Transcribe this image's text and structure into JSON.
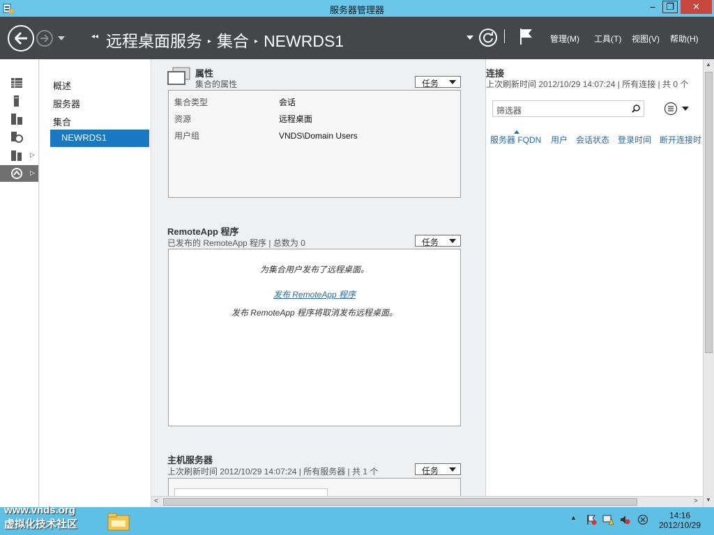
{
  "window": {
    "title": "服务器管理器",
    "minimize": "–",
    "maximize": "❐",
    "close": "✕"
  },
  "header": {
    "breadcrumb": [
      "远程桌面服务",
      "集合",
      "NEWRDS1"
    ],
    "menus": [
      "管理(M)",
      "工具(T)",
      "视图(V)",
      "帮助(H)"
    ]
  },
  "subnav": {
    "items": [
      "概述",
      "服务器",
      "集合"
    ],
    "selected": "NEWRDS1"
  },
  "properties": {
    "title": "属性",
    "subtitle": "集合的属性",
    "task_label": "任务",
    "rows": [
      {
        "key": "集合类型",
        "value": "会话"
      },
      {
        "key": "资源",
        "value": "远程桌面"
      },
      {
        "key": "用户组",
        "value": "VNDS\\Domain Users"
      }
    ]
  },
  "remoteapp": {
    "title": "RemoteApp 程序",
    "subtitle": "已发布的 RemoteApp 程序 | 总数为 0",
    "task_label": "任务",
    "line1": "为集合用户发布了远程桌面。",
    "link": "发布 RemoteApp 程序",
    "line2": "发布 RemoteApp 程序将取消发布远程桌面。"
  },
  "hosts": {
    "title": "主机服务器",
    "subtitle": "上次刷新时间 2012/10/29 14:07:24 | 所有服务器  | 共 1 个",
    "task_label": "任务"
  },
  "connections": {
    "title": "连接",
    "subtitle": "上次刷新时间 2012/10/29 14:07:24 | 所有连接  | 共 0 个",
    "filter_placeholder": "筛选器",
    "columns": [
      "服务器 FQDN",
      "用户",
      "会话状态",
      "登录时间",
      "断开连接时"
    ]
  },
  "taskbar": {
    "watermark_line1": "www.vnds.org",
    "watermark_line2": "虚拟化技术社区",
    "time": "14:16",
    "date": "2012/10/29"
  },
  "colors": {
    "titlebar": "#6ac6e8",
    "header": "#444649",
    "selection": "#1a78c2",
    "link": "#2a6aa8",
    "close": "#c7463d"
  }
}
